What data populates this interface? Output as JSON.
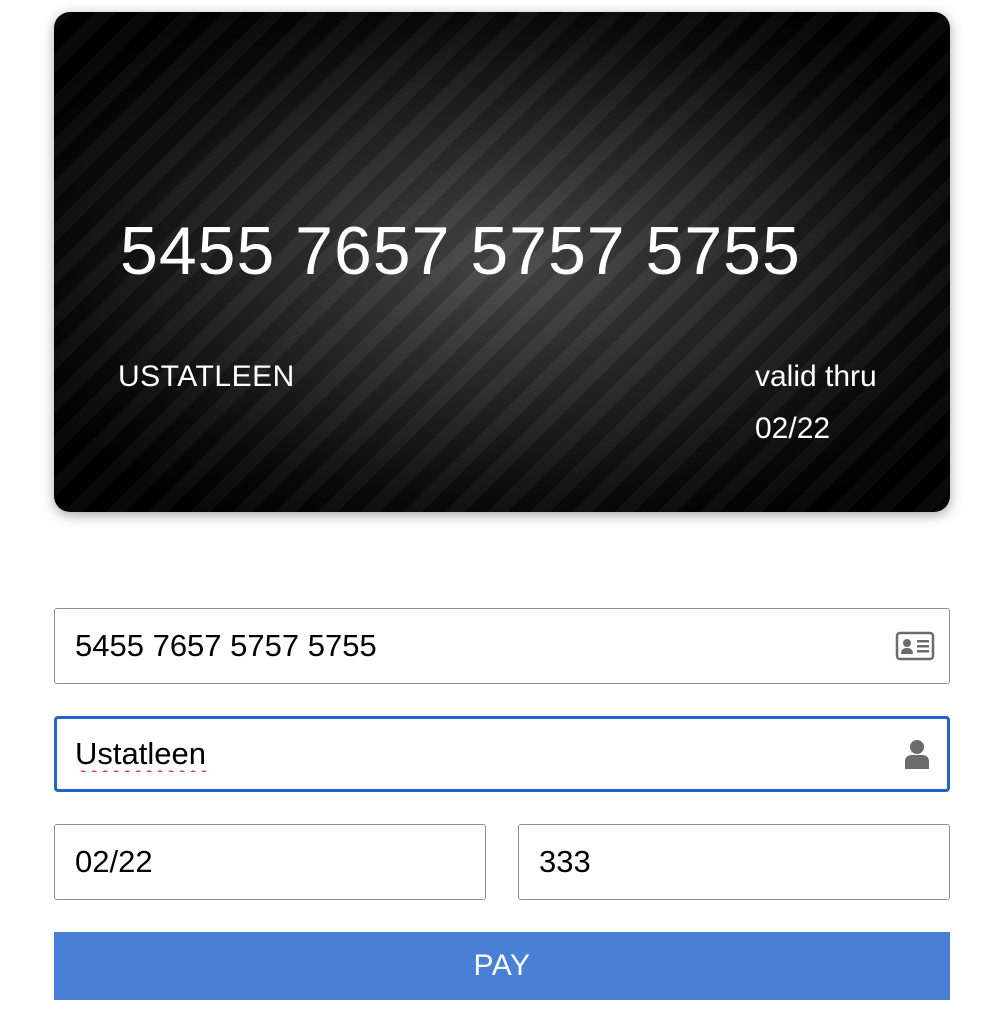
{
  "card": {
    "number": "5455 7657 5757 5755",
    "holder": "USTATLEEN",
    "valid_label": "valid thru",
    "valid_date": "02/22"
  },
  "form": {
    "card_number_value": "5455 7657 5757 5755",
    "card_number_icon": "id-card-icon",
    "name_value": "Ustatleen",
    "name_icon": "user-icon",
    "expiry_value": "02/22",
    "cvc_value": "333",
    "pay_label": "PAY"
  },
  "colors": {
    "focus_border": "#2563c9",
    "button_bg": "#4a7fd6",
    "button_text": "#ffffff",
    "card_text": "#ffffff"
  }
}
